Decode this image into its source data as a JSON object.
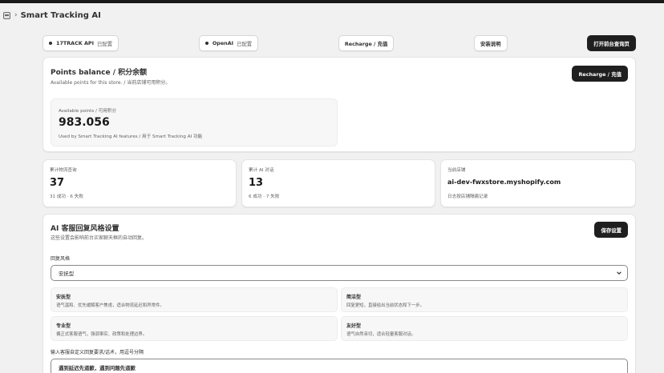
{
  "header": {
    "title": "Smart Tracking AI",
    "separator": "›"
  },
  "toolbar": {
    "api_17track": {
      "label": "17TRACK API",
      "status": "已配置"
    },
    "openai": {
      "label": "OpenAI",
      "status": "已配置"
    },
    "recharge_label": "Recharge / 充值",
    "install_guide_label": "安装说明",
    "open_frontend_label": "打开前台查询页"
  },
  "points": {
    "title": "Points balance / 积分余额",
    "subtitle": "Available points for this store. / 当前店铺可用积分。",
    "recharge_label": "Recharge / 充值",
    "available_label": "Available points / 可用积分",
    "available_value": "983.056",
    "note": "Used by Smart Tracking AI features / 用于 Smart Tracking AI 功能"
  },
  "stats": [
    {
      "label": "累计物流查询",
      "value": "37",
      "note": "31 成功 · 6 失败"
    },
    {
      "label": "累计 AI 对话",
      "value": "13",
      "note": "6 成功 · 7 失败"
    },
    {
      "label": "当前店铺",
      "value": "ai-dev-fwxstore.myshopify.com",
      "note": "日志按店铺隔离记录"
    }
  ],
  "ai_style": {
    "title": "AI 客服回复风格设置",
    "subtitle": "这些设置会影响前台买家聊天框的自动回复。",
    "save_label": "保存设置",
    "field_label": "回复风格",
    "selected": "安抚型",
    "options": [
      {
        "name": "安抚型",
        "desc": "语气温和、优先缓解客户焦虑，适合物流延迟和异常件。"
      },
      {
        "name": "简洁型",
        "desc": "回复更短，直接给出当前状态和下一步。"
      },
      {
        "name": "专业型",
        "desc": "偏正式客服语气，强调事实、政策和处理边界。"
      },
      {
        "name": "友好型",
        "desc": "语气自然亲切，适合轻量客服对话。"
      }
    ],
    "custom_label": "输入客服自定义回复要求/话术，用逗号分隔",
    "custom_value": "遇到延迟先道歉，遇到问题先道歉"
  }
}
